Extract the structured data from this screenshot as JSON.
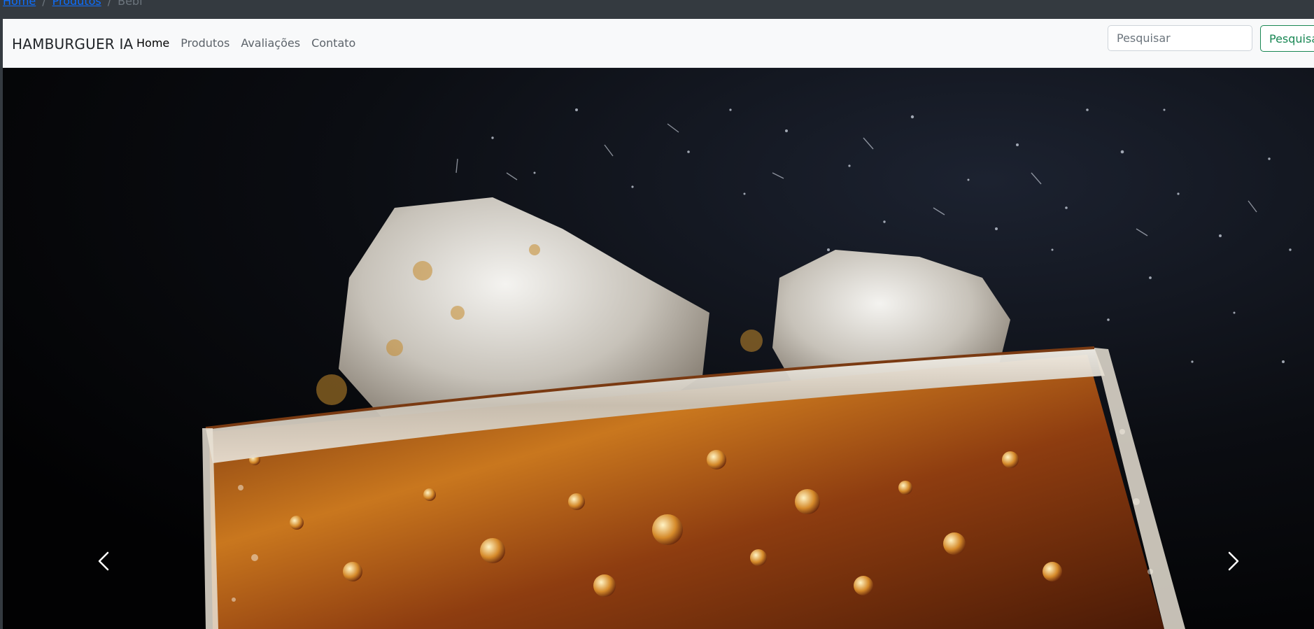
{
  "breadcrumb": {
    "items": [
      {
        "label": "Home"
      },
      {
        "label": "Produtos"
      }
    ],
    "current": "Bebi",
    "separator": "/"
  },
  "navbar": {
    "brand": "HAMBURGUER IA",
    "links": [
      {
        "label": "Home",
        "active": true
      },
      {
        "label": "Produtos",
        "active": false
      },
      {
        "label": "Avaliações",
        "active": false
      },
      {
        "label": "Contato",
        "active": false
      }
    ]
  },
  "search": {
    "placeholder": "Pesquisar",
    "value": "",
    "button_label": "Pesquisar"
  },
  "carousel": {
    "image_icon": "cola-glass-with-ice-photo",
    "prev_icon": "chevron-left-icon",
    "next_icon": "chevron-right-icon"
  },
  "colors": {
    "topbar": "#343a40",
    "navbar_bg": "#f8f9fa",
    "link": "#0d6efd",
    "success": "#198754"
  }
}
